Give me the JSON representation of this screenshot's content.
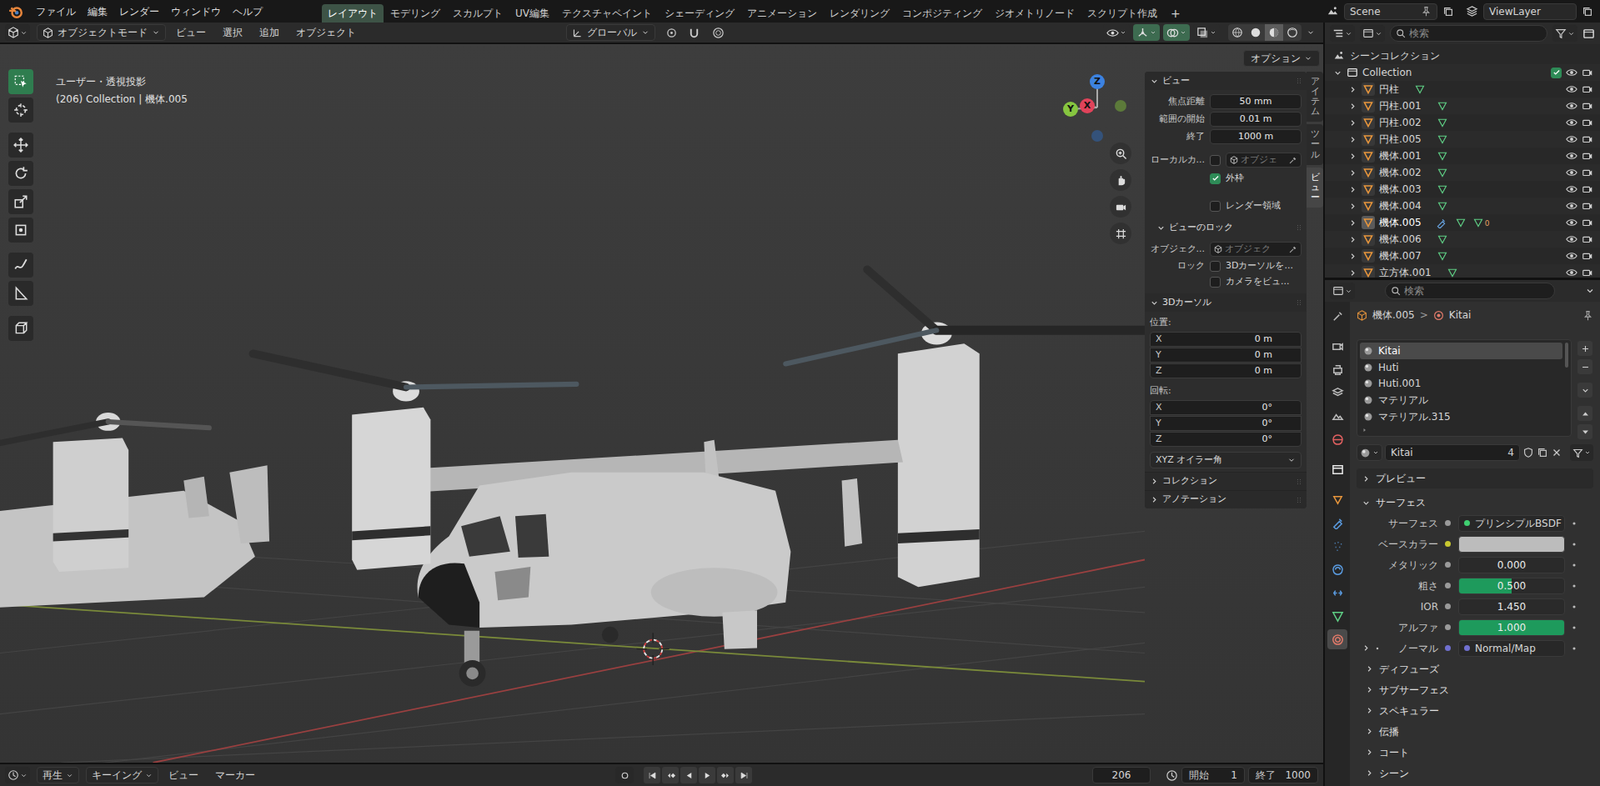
{
  "menubar": {
    "menus": [
      "ファイル",
      "編集",
      "レンダー",
      "ウィンドウ",
      "ヘルプ"
    ],
    "workspaces": [
      {
        "label": "レイアウト",
        "selected": true
      },
      {
        "label": "モデリング",
        "selected": false
      },
      {
        "label": "スカルプト",
        "selected": false
      },
      {
        "label": "UV編集",
        "selected": false
      },
      {
        "label": "テクスチャペイント",
        "selected": false
      },
      {
        "label": "シェーディング",
        "selected": false
      },
      {
        "label": "アニメーション",
        "selected": false
      },
      {
        "label": "レンダリング",
        "selected": false
      },
      {
        "label": "コンポジティング",
        "selected": false
      },
      {
        "label": "ジオメトリノード",
        "selected": false
      },
      {
        "label": "スクリプト作成",
        "selected": false
      }
    ],
    "add_workspace": "+",
    "scene": "Scene",
    "view_layer": "ViewLayer"
  },
  "viewport_header": {
    "mode": "オブジェクトモード",
    "menus": [
      "ビュー",
      "選択",
      "追加",
      "オブジェクト"
    ],
    "orientation": "グローバル",
    "options": "オプション",
    "toggles": [
      {
        "kind": "visibility",
        "on": false
      },
      {
        "kind": "gizmo",
        "on": true
      },
      {
        "kind": "overlay",
        "on": true
      },
      {
        "kind": "xray",
        "on": false
      }
    ],
    "shading": [
      {
        "kind": "wireframe",
        "selected": false
      },
      {
        "kind": "solid",
        "selected": false
      },
      {
        "kind": "material",
        "selected": true
      },
      {
        "kind": "rendered",
        "selected": false
      }
    ]
  },
  "viewport": {
    "view_name": "ユーザー・透視投影",
    "context": "(206) Collection | 機体.005",
    "gizmo": [
      {
        "label": "X",
        "color": "#e0435a"
      },
      {
        "label": "Y",
        "color": "#86c540"
      },
      {
        "label": "Z",
        "color": "#3c82e0"
      }
    ]
  },
  "toolbar": [
    {
      "kind": "select",
      "selected": true
    },
    {
      "kind": "cursor",
      "selected": false
    },
    {
      "kind": "move",
      "selected": false
    },
    {
      "kind": "rotate",
      "selected": false
    },
    {
      "kind": "scale",
      "selected": false
    },
    {
      "kind": "transform",
      "selected": false
    },
    {
      "kind": "annotate",
      "selected": false
    },
    {
      "kind": "measure",
      "selected": false
    },
    {
      "kind": "add_cube",
      "selected": false
    }
  ],
  "sidebar": {
    "tabs": [
      {
        "label": "アイテム",
        "selected": false
      },
      {
        "label": "ツール",
        "selected": false
      },
      {
        "label": "ビュー",
        "selected": true
      }
    ],
    "view": {
      "title": "ビュー",
      "expanded": true,
      "fields": [
        {
          "label": "焦点距離",
          "value": "50 mm"
        },
        {
          "label": "範囲の開始",
          "value": "0.01 m"
        },
        {
          "label": "終了",
          "value": "1000 m"
        }
      ],
      "local_camera": {
        "label": "ローカルカ...",
        "checked": false,
        "placeholder": "オブジェ"
      },
      "outline": {
        "label": "外枠",
        "checked": true
      },
      "render_region": {
        "label": "レンダー領域",
        "checked": false
      },
      "lock": {
        "title": "ビューのロック",
        "expanded": true,
        "object_label": "オブジェク...",
        "object_placeholder": "オブジェク",
        "lock_label": "ロック",
        "options": [
          {
            "label": "3Dカーソルを...",
            "checked": false
          },
          {
            "label": "カメラをビュ...",
            "checked": false
          }
        ]
      }
    },
    "cursor": {
      "title": "3Dカーソル",
      "expanded": true,
      "location_label": "位置:",
      "location": [
        {
          "axis": "X",
          "value": "0 m"
        },
        {
          "axis": "Y",
          "value": "0 m"
        },
        {
          "axis": "Z",
          "value": "0 m"
        }
      ],
      "rotation_label": "回転:",
      "rotation": [
        {
          "axis": "X",
          "value": "0°"
        },
        {
          "axis": "Y",
          "value": "0°"
        },
        {
          "axis": "Z",
          "value": "0°"
        }
      ],
      "rotation_mode": "XYZ オイラー角"
    },
    "collapsed": [
      {
        "title": "コレクション",
        "expanded": false
      },
      {
        "title": "アノテーション",
        "expanded": false
      }
    ]
  },
  "outliner": {
    "search_placeholder": "検索",
    "scene_collection": "シーンコレクション",
    "collection": {
      "name": "Collection",
      "checked": true,
      "expanded": true
    },
    "objects": [
      {
        "name": "円柱",
        "active": false,
        "expanded": false
      },
      {
        "name": "円柱.001",
        "active": false,
        "expanded": false
      },
      {
        "name": "円柱.002",
        "active": false,
        "expanded": false
      },
      {
        "name": "円柱.005",
        "active": false,
        "expanded": false
      },
      {
        "name": "機体.001",
        "active": false,
        "expanded": false
      },
      {
        "name": "機体.002",
        "active": false,
        "expanded": false
      },
      {
        "name": "機体.003",
        "active": false,
        "expanded": false
      },
      {
        "name": "機体.004",
        "active": false,
        "expanded": false
      },
      {
        "name": "機体.005",
        "active": true,
        "expanded": false,
        "badge": "0"
      },
      {
        "name": "機体.006",
        "active": false,
        "expanded": false
      },
      {
        "name": "機体.007",
        "active": false,
        "expanded": false
      },
      {
        "name": "立方体.001",
        "active": false,
        "expanded": false
      }
    ]
  },
  "properties": {
    "search_placeholder": "検索",
    "tabs": [
      {
        "kind": "tool",
        "selected": false
      },
      {
        "kind": "render",
        "selected": false
      },
      {
        "kind": "output",
        "selected": false
      },
      {
        "kind": "view_layer",
        "selected": false
      },
      {
        "kind": "scene",
        "selected": false
      },
      {
        "kind": "world",
        "selected": false
      },
      {
        "kind": "collection",
        "selected": false
      },
      {
        "kind": "object",
        "selected": false
      },
      {
        "kind": "modifier",
        "selected": false
      },
      {
        "kind": "particles",
        "selected": false
      },
      {
        "kind": "physics",
        "selected": false
      },
      {
        "kind": "constraints",
        "selected": false
      },
      {
        "kind": "data",
        "selected": false
      },
      {
        "kind": "material",
        "selected": true
      }
    ],
    "breadcrumb": {
      "object": "機体.005",
      "separator": ">",
      "material": "Kitai"
    },
    "slots": [
      {
        "name": "Kitai",
        "selected": true
      },
      {
        "name": "Huti",
        "selected": false
      },
      {
        "name": "Huti.001",
        "selected": false
      },
      {
        "name": "マテリアル",
        "selected": false
      },
      {
        "name": "マテリアル.315",
        "selected": false
      }
    ],
    "material": {
      "name": "Kitai",
      "users": "4"
    },
    "preview": {
      "title": "プレビュー",
      "expanded": false
    },
    "surface": {
      "title": "サーフェス",
      "expanded": true,
      "rows": [
        {
          "kind": "shader",
          "label": "サーフェス",
          "value": "プリンシプルBSDF"
        },
        {
          "kind": "color",
          "label": "ベースカラー",
          "color": "#bcbcbc"
        },
        {
          "kind": "slider",
          "label": "メタリック",
          "value": "0.000",
          "level": 0
        },
        {
          "kind": "slider",
          "label": "粗さ",
          "value": "0.500",
          "level": 0.5
        },
        {
          "kind": "number",
          "label": "IOR",
          "value": "1.450"
        },
        {
          "kind": "slider",
          "label": "アルファ",
          "value": "1.000",
          "level": 1
        },
        {
          "kind": "link",
          "label": "ノーマル",
          "value": "Normal/Map",
          "expanded": false
        }
      ]
    },
    "subpanels": [
      {
        "title": "ディフューズ",
        "expanded": false
      },
      {
        "title": "サブサーフェス",
        "expanded": false
      },
      {
        "title": "スペキュラー",
        "expanded": false
      },
      {
        "title": "伝播",
        "expanded": false
      },
      {
        "title": "コート",
        "expanded": false
      },
      {
        "title": "シーン",
        "expanded": false
      }
    ]
  },
  "timeline": {
    "play": "再生",
    "keying": "キーイング",
    "menus": [
      "ビュー",
      "マーカー"
    ],
    "frame": "206",
    "start_label": "開始",
    "start": "1",
    "end_label": "終了",
    "end": "1000"
  }
}
